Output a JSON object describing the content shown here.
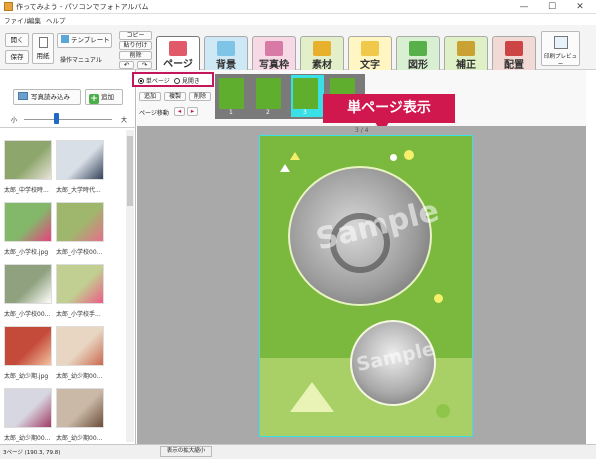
{
  "window": {
    "title": "作ってみよう - パソコンでフォトアルバム",
    "minimize": "—",
    "maximize": "☐",
    "close": "✕"
  },
  "menu": [
    "ファイル",
    "編集",
    "ヘルプ"
  ],
  "toolbar": {
    "open": "開く",
    "save": "保存",
    "paper": "用紙",
    "template": "テンプレート",
    "manual": "操作マニュアル",
    "copy": "コピー",
    "paste": "貼り付け",
    "delete": "削除",
    "undo": "↶",
    "redo": "↷",
    "print_preview": "印刷プレビュー"
  },
  "tabs": [
    {
      "label": "ページ",
      "color": "#ffffff",
      "pic": "#e05a6a"
    },
    {
      "label": "背景",
      "color": "#cfe8f6",
      "pic": "#7ec4e6"
    },
    {
      "label": "写真枠",
      "color": "#f7d9e6",
      "pic": "#d97aa6"
    },
    {
      "label": "素材",
      "color": "#e2efc8",
      "pic": "#e8b12d"
    },
    {
      "label": "文字",
      "color": "#fff6c4",
      "pic": "#f0c94a"
    },
    {
      "label": "図形",
      "color": "#d8efd1",
      "pic": "#57b04a"
    },
    {
      "label": "補正",
      "color": "#dff0c6",
      "pic": "#c9a233"
    },
    {
      "label": "配置",
      "color": "#f1d9d6",
      "pic": "#c44"
    }
  ],
  "left": {
    "load_photos": "写真読み込み",
    "add": "追加",
    "size_small": "小",
    "size_large": "大",
    "thumbnails": [
      {
        "caption": "太郎_中学校時...",
        "bg": "#8da66c",
        "fg": "#e9e3d8"
      },
      {
        "caption": "太郎_大学時代...",
        "bg": "#d9dfe6",
        "fg": "#33415a"
      },
      {
        "caption": "太郎_小学校.jpg",
        "bg": "#83b86a",
        "fg": "#e8417f"
      },
      {
        "caption": "太郎_小学校00...",
        "bg": "#9fb76c",
        "fg": "#e66f8b"
      },
      {
        "caption": "太郎_小学校00...",
        "bg": "#8fa17e",
        "fg": "#ffffff"
      },
      {
        "caption": "太郎_小学校手...",
        "bg": "#c1d092",
        "fg": "#ec5d86"
      },
      {
        "caption": "太郎_幼少期.jpg",
        "bg": "#c44a3a",
        "fg": "#f4c3a0"
      },
      {
        "caption": "太郎_幼少期00...",
        "bg": "#e8d6c2",
        "fg": "#c96a4e"
      },
      {
        "caption": "太郎_幼少期00...",
        "bg": "#d7d7e2",
        "fg": "#a23b63"
      },
      {
        "caption": "太郎_幼少期00...",
        "bg": "#c9b9a6",
        "fg": "#6b4c3a"
      }
    ]
  },
  "page_panel": {
    "single_page": "単ページ",
    "spread": "見開き",
    "add": "追加",
    "duplicate": "複製",
    "remove": "削除",
    "page_move": "ページ移動",
    "pages": [
      "1",
      "2",
      "3",
      "4"
    ]
  },
  "callout": "単ページ表示",
  "page_indicator": "3 / 4",
  "watermark": "Sample",
  "status": {
    "coords": "3ページ (190.3, 79.8)",
    "zoom": "表示の拡大縮小"
  },
  "colors": {
    "page_green": "#7bb83e",
    "page_light_green": "#a9d067",
    "selection_cyan": "#39e0e6",
    "callout": "#d0184f"
  }
}
